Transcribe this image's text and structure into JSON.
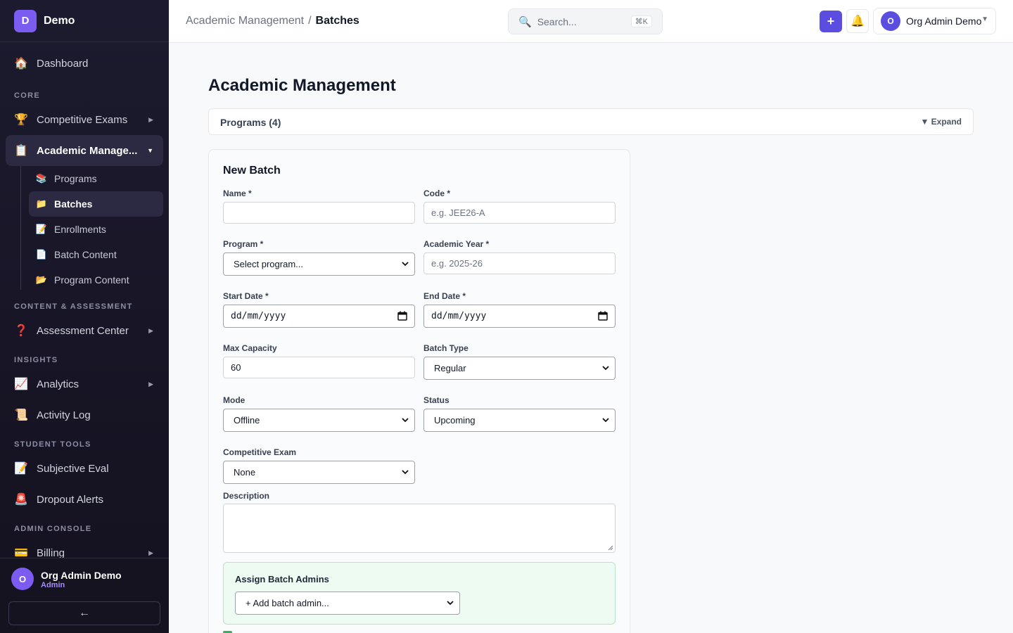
{
  "brand": {
    "logo_letter": "D",
    "name": "Demo",
    "accent": "#7c5cf0"
  },
  "sidebar": {
    "dashboard": {
      "label": "Dashboard",
      "icon": "house-icon"
    },
    "sections": {
      "core": "CORE",
      "content": "CONTENT & ASSESSMENT",
      "insights": "INSIGHTS",
      "student": "STUDENT TOOLS",
      "admin": "ADMIN CONSOLE"
    },
    "items": {
      "competitive_exams": "Competitive Exams",
      "academic": "Academic Manage...",
      "assessment": "Assessment Center",
      "analytics": "Analytics",
      "activity": "Activity Log",
      "subjective": "Subjective Eval",
      "dropout": "Dropout Alerts",
      "billing": "Billing"
    },
    "sub_items": {
      "programs": "Programs",
      "batches": "Batches",
      "enrollments": "Enrollments",
      "batch_content": "Batch Content",
      "program_content": "Program Content"
    },
    "user": {
      "avatar": "O",
      "name": "Org Admin Demo",
      "role": "Admin"
    },
    "collapse": "←"
  },
  "topbar": {
    "breadcrumb": {
      "parent": "Academic Management",
      "separator": "/",
      "current": "Batches"
    },
    "search": {
      "placeholder": "Search...",
      "shortcut": "⌘K"
    },
    "add": "+",
    "user": {
      "avatar": "O",
      "name": "Org Admin Demo",
      "caret": "▼"
    }
  },
  "main": {
    "title": "Academic Management",
    "programs": {
      "label": "Programs (4)",
      "toggle": "▼ Expand"
    },
    "form": {
      "title": "New Batch",
      "name": {
        "label": "Name *",
        "value": ""
      },
      "code": {
        "label": "Code *",
        "placeholder": "e.g. JEE26-A"
      },
      "program": {
        "label": "Program *",
        "value": "Select program..."
      },
      "academic_year": {
        "label": "Academic Year *",
        "placeholder": "e.g. 2025-26"
      },
      "start_date": {
        "label": "Start Date *",
        "value": "dd/mm/yyyy"
      },
      "end_date": {
        "label": "End Date *",
        "value": "dd/mm/yyyy"
      },
      "max_capacity": {
        "label": "Max Capacity",
        "value": "60"
      },
      "batch_type": {
        "label": "Batch Type",
        "value": "Regular"
      },
      "mode": {
        "label": "Mode",
        "value": "Offline"
      },
      "status": {
        "label": "Status",
        "value": "Upcoming"
      },
      "competitive_exam": {
        "label": "Competitive Exam",
        "value": "None"
      },
      "description": {
        "label": "Description",
        "value": ""
      },
      "batch_admins": {
        "title": "Assign Batch Admins",
        "value": "+ Add batch admin..."
      }
    }
  }
}
